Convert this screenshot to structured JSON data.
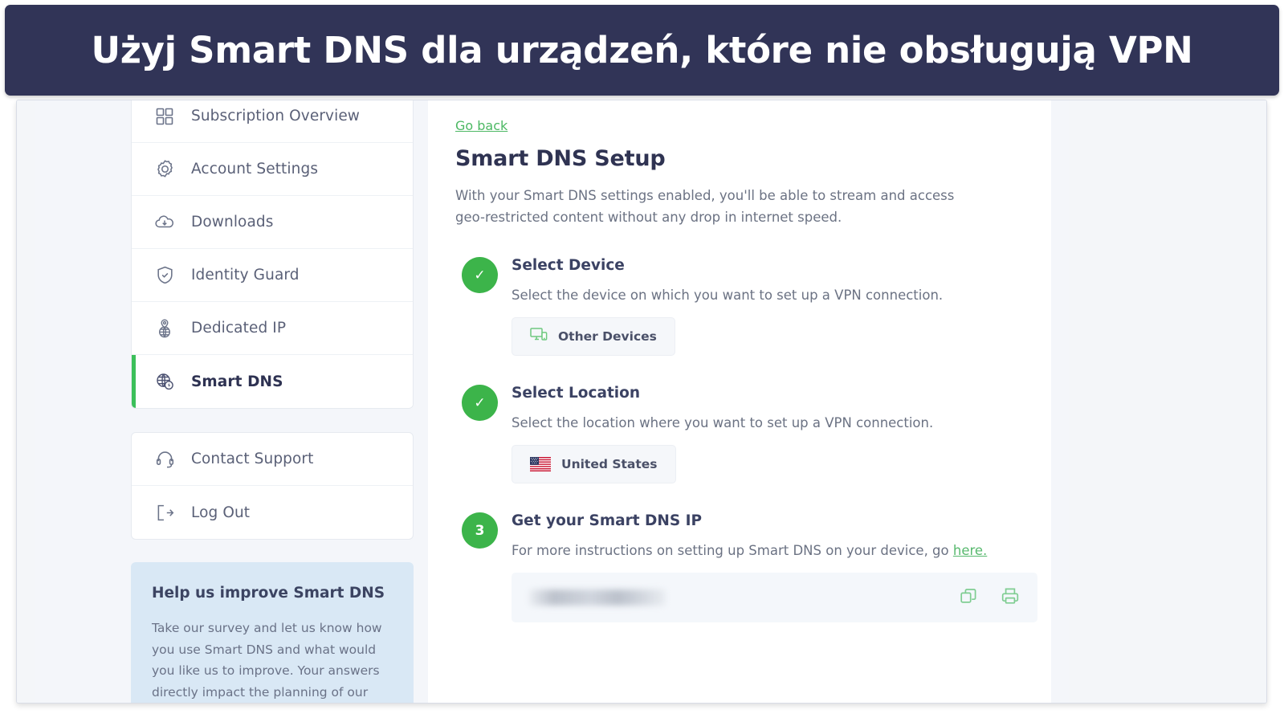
{
  "banner": {
    "title": "Użyj Smart DNS dla urządzeń, które nie obsługują VPN",
    "bg_color": "#313457",
    "text_color": "#ffffff"
  },
  "colors": {
    "accent_green": "#3cb44a",
    "link_green": "#4cb863",
    "navy": "#2f3352",
    "body_text": "#6b7283",
    "help_bg": "#d9e8f5"
  },
  "sidebar": {
    "primary_items": [
      {
        "label": "Subscription Overview",
        "icon": "grid-icon",
        "active": false
      },
      {
        "label": "Account Settings",
        "icon": "gear-icon",
        "active": false
      },
      {
        "label": "Downloads",
        "icon": "cloud-download-icon",
        "active": false
      },
      {
        "label": "Identity Guard",
        "icon": "shield-check-icon",
        "active": false
      },
      {
        "label": "Dedicated IP",
        "icon": "globe-pin-icon",
        "active": false
      },
      {
        "label": "Smart DNS",
        "icon": "globe-bolt-icon",
        "active": true
      }
    ],
    "secondary_items": [
      {
        "label": "Contact Support",
        "icon": "headset-icon"
      },
      {
        "label": "Log Out",
        "icon": "logout-icon"
      }
    ],
    "help": {
      "title": "Help us improve Smart DNS",
      "body": "Take our survey and let us know how you use Smart DNS and what would you like us to improve. Your answers directly impact the planning of our roadmap."
    }
  },
  "main": {
    "go_back": "Go back",
    "title": "Smart DNS Setup",
    "description": "With your Smart DNS settings enabled, you'll be able to stream and access geo-restricted content without any drop in internet speed.",
    "steps": [
      {
        "badge": "✓",
        "state": "complete",
        "title": "Select Device",
        "description": "Select the device on which you want to set up a VPN connection.",
        "chip_label": "Other Devices",
        "chip_icon": "devices-icon"
      },
      {
        "badge": "✓",
        "state": "complete",
        "title": "Select Location",
        "description": "Select the location where you want to set up a VPN connection.",
        "chip_label": "United States",
        "chip_icon": "us-flag-icon"
      },
      {
        "badge": "3",
        "state": "current",
        "title": "Get your Smart DNS IP",
        "description_prefix": "For more instructions on setting up Smart DNS on your device, go ",
        "description_link": "here.",
        "ip_value": "",
        "ip_redacted": true,
        "actions": [
          {
            "name": "copy-icon",
            "label": "Copy"
          },
          {
            "name": "print-icon",
            "label": "Print"
          }
        ]
      }
    ]
  }
}
